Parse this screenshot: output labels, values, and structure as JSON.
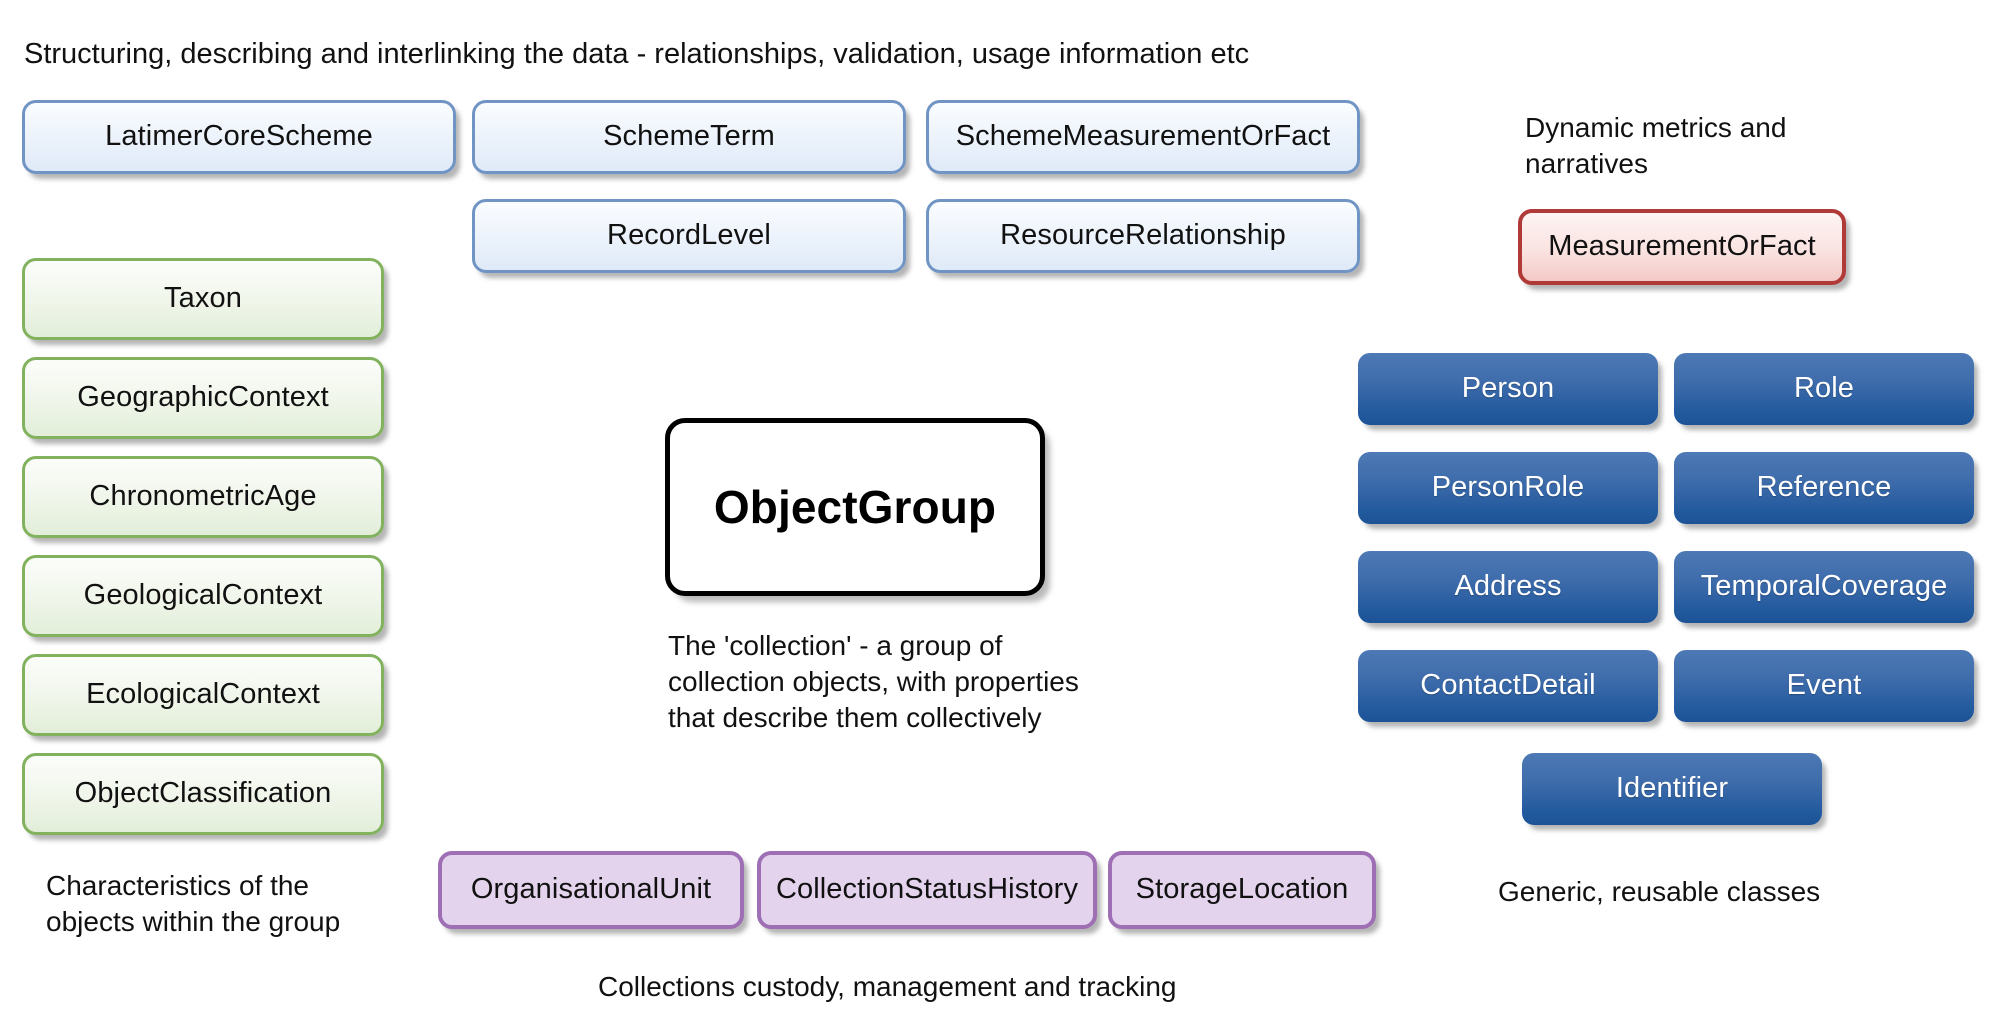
{
  "diagram": {
    "title_banner": "Structuring, describing and interlinking the data - relationships, validation, usage information etc",
    "captions": {
      "dynamic_metrics": "Dynamic metrics and\nnarratives",
      "characteristics": "Characteristics of the\nobjects within the group",
      "generic_classes": "Generic, reusable classes",
      "collections_custody": "Collections custody, management and tracking",
      "object_group_description": "The 'collection' - a group of\ncollection objects, with properties\nthat describe them collectively"
    },
    "center_node": {
      "label": "ObjectGroup"
    },
    "groups": {
      "scheme": {
        "color": "#7095c4",
        "nodes": [
          "LatimerCoreScheme",
          "SchemeTerm",
          "SchemeMeasurementOrFact",
          "RecordLevel",
          "ResourceRelationship"
        ]
      },
      "characteristics": {
        "color": "#82b25e",
        "nodes": [
          "Taxon",
          "GeographicContext",
          "ChronometricAge",
          "GeologicalContext",
          "EcologicalContext",
          "ObjectClassification"
        ]
      },
      "metrics": {
        "color": "#b03a38",
        "nodes": [
          "MeasurementOrFact"
        ]
      },
      "generic": {
        "color": "#225a9e",
        "nodes": [
          "Person",
          "Role",
          "PersonRole",
          "Reference",
          "Address",
          "TemporalCoverage",
          "ContactDetail",
          "Event",
          "Identifier"
        ]
      },
      "custody": {
        "color": "#9e6fb4",
        "nodes": [
          "OrganisationalUnit",
          "CollectionStatusHistory",
          "StorageLocation"
        ]
      }
    }
  }
}
